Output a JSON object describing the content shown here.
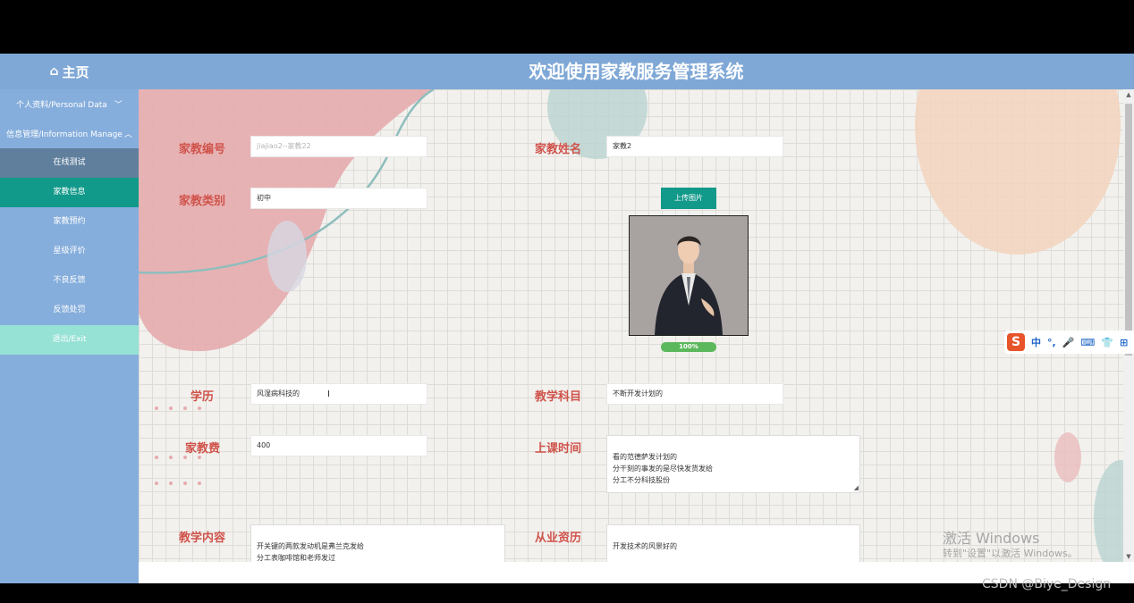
{
  "header": {
    "home_icon": "home-icon",
    "home_label": "主页",
    "title": "欢迎使用家教服务管理系统"
  },
  "sidebar": {
    "groups": [
      {
        "label": "个人资料/Personal Data",
        "chevron": "﹀"
      },
      {
        "label": "信息管理/Information Manage",
        "chevron": "︿"
      }
    ],
    "items": [
      {
        "label": "在线测试"
      },
      {
        "label": "家教信息"
      },
      {
        "label": "家教预约"
      },
      {
        "label": "星级评价"
      },
      {
        "label": "不良反馈"
      },
      {
        "label": "反馈处罚"
      },
      {
        "label": "退出/Exit"
      }
    ]
  },
  "form": {
    "tutor_id": {
      "label": "家教编号",
      "placeholder": "jiajiao2--家教22"
    },
    "tutor_name": {
      "label": "家教姓名",
      "value": "家教2"
    },
    "tutor_category": {
      "label": "家教类别",
      "value": "初中"
    },
    "upload": {
      "button": "上传图片",
      "progress": "100%"
    },
    "education": {
      "label": "学历",
      "value": "风湿病科技的"
    },
    "subject": {
      "label": "教学科目",
      "value": "不断开发计划的"
    },
    "fee": {
      "label": "家教费",
      "value": "400"
    },
    "class_time": {
      "label": "上课时间",
      "value": "看的范德萨发计划的\n分干刻的事发的是尽快发货发给\n分工不分科技股份"
    },
    "content": {
      "label": "教学内容",
      "value": "开关键的两款发动机是弗兰克发给\n分工表咖啡馆和老师发过\n给你发的了规范里看过"
    },
    "experience": {
      "label": "从业资历",
      "value": "开发技术的风景好的"
    }
  },
  "ime": {
    "logo": "S",
    "glyphs": [
      "中",
      "°,",
      "🎤",
      "⌨",
      "👕",
      "⊞"
    ]
  },
  "overlay": {
    "activate_line1": "激活 Windows",
    "activate_line2": "转到\"设置\"以激活 Windows。",
    "credit": "CSDN @Biye_Design"
  }
}
